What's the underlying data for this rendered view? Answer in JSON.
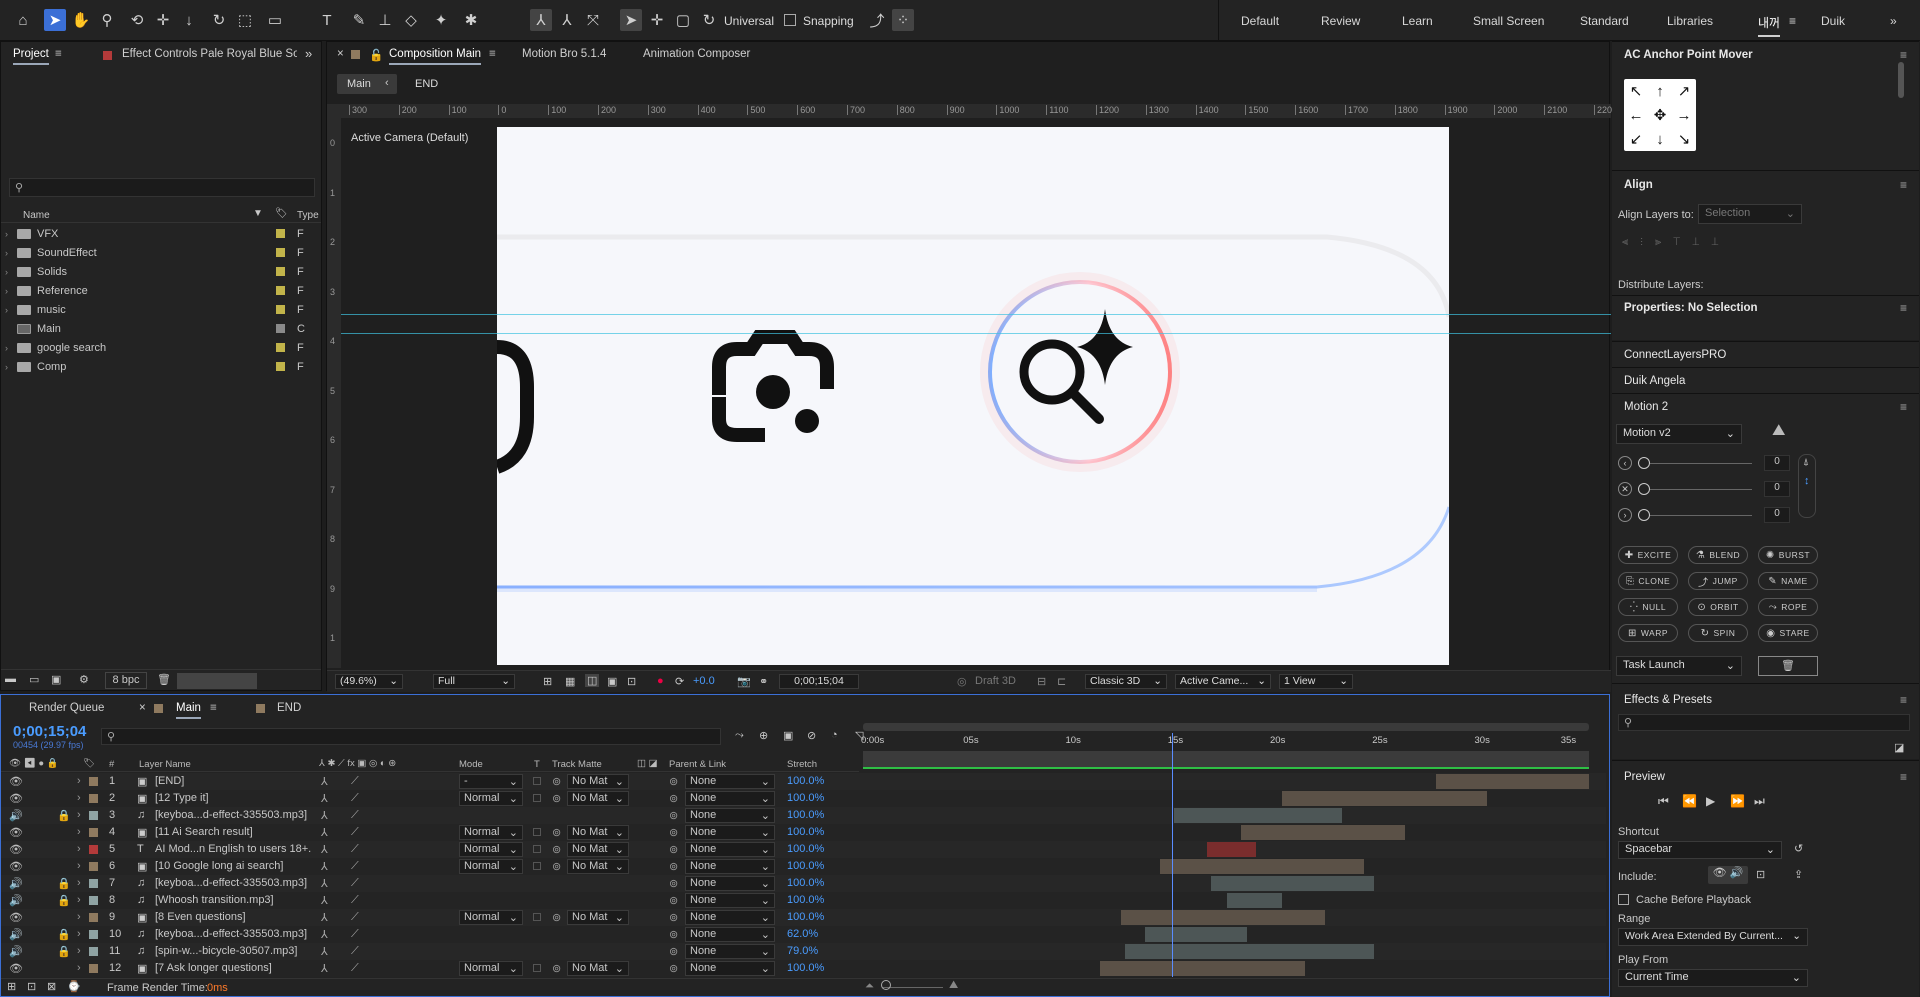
{
  "toolbar": {
    "universal": "Universal",
    "snapping": "Snapping",
    "workspaces": [
      "Default",
      "Review",
      "Learn",
      "Small Screen",
      "Standard",
      "Libraries",
      "내꺼",
      "Duik"
    ]
  },
  "project_panel": {
    "tab_project": "Project",
    "tab_effect_controls": "Effect Controls Pale Royal Blue Solid",
    "col_name": "Name",
    "col_type": "Type",
    "items": [
      {
        "name": "VFX",
        "type": "F",
        "color": "#c2b44a"
      },
      {
        "name": "SoundEffect",
        "type": "F",
        "color": "#c2b44a"
      },
      {
        "name": "Solids",
        "type": "F",
        "color": "#c2b44a"
      },
      {
        "name": "Reference",
        "type": "F",
        "color": "#c2b44a"
      },
      {
        "name": "music",
        "type": "F",
        "color": "#c2b44a"
      },
      {
        "name": "Main",
        "type": "C",
        "color": "#8a8a8a"
      },
      {
        "name": "google search",
        "type": "F",
        "color": "#c2b44a"
      },
      {
        "name": "Comp",
        "type": "F",
        "color": "#c2b44a"
      }
    ],
    "bpc": "8 bpc"
  },
  "comp_panel": {
    "tab_comp": "Composition Main",
    "tab_motion_bro": "Motion Bro 5.1.4",
    "tab_anim_composer": "Animation Composer",
    "flow_main": "Main",
    "flow_end": "END",
    "active_camera": "Active Camera (Default)",
    "ruler_top": [
      "300",
      "200",
      "100",
      "0",
      "100",
      "200",
      "300",
      "400",
      "500",
      "600",
      "700",
      "800",
      "900",
      "1000",
      "1100",
      "1200",
      "1300",
      "1400",
      "1500",
      "1600",
      "1700",
      "1800",
      "1900",
      "2000",
      "2100",
      "220"
    ],
    "ruler_left": [
      "0",
      "1",
      "2",
      "3",
      "4",
      "5",
      "6",
      "7",
      "8",
      "9",
      "1"
    ],
    "footer": {
      "zoom": "(49.6%)",
      "resolution": "Full",
      "exposure": "+0.0",
      "timecode": "0;00;15;04",
      "draft3d": "Draft 3D",
      "renderer": "Classic 3D",
      "camera": "Active Came...",
      "views": "1 View"
    }
  },
  "timeline": {
    "tab_render_queue": "Render Queue",
    "tab_main": "Main",
    "tab_end": "END",
    "timecode": "0;00;15;04",
    "frames": "00454 (29.97 fps)",
    "headers": {
      "num": "#",
      "layer_name": "Layer Name",
      "mode": "Mode",
      "t": "T",
      "track_matte": "Track Matte",
      "parent": "Parent & Link",
      "stretch": "Stretch"
    },
    "ruler": [
      "0:00s",
      "05s",
      "10s",
      "15s",
      "20s",
      "25s",
      "30s",
      "35s"
    ],
    "playhead": 15.1,
    "duration": 35.5,
    "layers": [
      {
        "num": "1",
        "name": "[END]",
        "mode": "-",
        "matte": "No Mat",
        "parent": "None",
        "stretch": "100.0%",
        "icon": "comp",
        "label": "#8f7a5f",
        "bar_start": 28,
        "bar_end": 35.5,
        "bar_color": "#5b5147"
      },
      {
        "num": "2",
        "name": "[12 Type it]",
        "mode": "Normal",
        "matte": "No Mat",
        "parent": "None",
        "stretch": "100.0%",
        "icon": "comp",
        "label": "#8f7a5f",
        "bar_start": 20.5,
        "bar_end": 30.5,
        "bar_color": "#5b5147"
      },
      {
        "num": "3",
        "name": "[keyboa...d-effect-335503.mp3]",
        "mode": "",
        "matte": "",
        "parent": "None",
        "stretch": "100.0%",
        "icon": "audio",
        "label": "#8fa3a3",
        "bar_start": 15.2,
        "bar_end": 23.4,
        "bar_color": "#4d5656"
      },
      {
        "num": "4",
        "name": "[11 Ai Search result]",
        "mode": "Normal",
        "matte": "No Mat",
        "parent": "None",
        "stretch": "100.0%",
        "icon": "comp",
        "label": "#8f7a5f",
        "bar_start": 18.5,
        "bar_end": 26.5,
        "bar_color": "#5b5147"
      },
      {
        "num": "5",
        "name": "AI Mod...n English to users 18+.",
        "mode": "Normal",
        "matte": "No Mat",
        "parent": "None",
        "stretch": "100.0%",
        "icon": "text",
        "label": "#b33a3a",
        "bar_start": 16.8,
        "bar_end": 19.2,
        "bar_color": "#7a2d2d"
      },
      {
        "num": "6",
        "name": "[10 Google long ai search]",
        "mode": "Normal",
        "matte": "No Mat",
        "parent": "None",
        "stretch": "100.0%",
        "icon": "comp",
        "label": "#8f7a5f",
        "bar_start": 14.5,
        "bar_end": 24.5,
        "bar_color": "#5b5147"
      },
      {
        "num": "7",
        "name": "[keyboa...d-effect-335503.mp3]",
        "mode": "",
        "matte": "",
        "parent": "None",
        "stretch": "100.0%",
        "icon": "audio",
        "label": "#8fa3a3",
        "bar_start": 17,
        "bar_end": 25,
        "bar_color": "#4d5656"
      },
      {
        "num": "8",
        "name": "[Whoosh transition.mp3]",
        "mode": "",
        "matte": "",
        "parent": "None",
        "stretch": "100.0%",
        "icon": "audio",
        "label": "#8fa3a3",
        "bar_start": 17.8,
        "bar_end": 20.5,
        "bar_color": "#4d5656"
      },
      {
        "num": "9",
        "name": "[8 Even questions]",
        "mode": "Normal",
        "matte": "No Mat",
        "parent": "None",
        "stretch": "100.0%",
        "icon": "comp",
        "label": "#8f7a5f",
        "bar_start": 12.6,
        "bar_end": 22.6,
        "bar_color": "#5b5147"
      },
      {
        "num": "10",
        "name": "[keyboa...d-effect-335503.mp3]",
        "mode": "",
        "matte": "",
        "parent": "None",
        "stretch": "62.0%",
        "icon": "audio",
        "label": "#8fa3a3",
        "bar_start": 13.8,
        "bar_end": 18.8,
        "bar_color": "#4d5656"
      },
      {
        "num": "11",
        "name": "[spin-w...-bicycle-30507.mp3]",
        "mode": "",
        "matte": "",
        "parent": "None",
        "stretch": "79.0%",
        "icon": "audio",
        "label": "#8fa3a3",
        "bar_start": 12.8,
        "bar_end": 25,
        "bar_color": "#4d5656"
      },
      {
        "num": "12",
        "name": "[7 Ask longer questions]",
        "mode": "Normal",
        "matte": "No Mat",
        "parent": "None",
        "stretch": "100.0%",
        "icon": "comp",
        "label": "#8f7a5f",
        "bar_start": 11.6,
        "bar_end": 21.6,
        "bar_color": "#5b5147"
      }
    ],
    "frame_render_label": "Frame Render Time:",
    "frame_render_value": "0ms"
  },
  "right": {
    "anchor_title": "AC Anchor Point Mover",
    "align_title": "Align",
    "align_to_label": "Align Layers to:",
    "align_to_value": "Selection",
    "distribute": "Distribute Layers:",
    "properties": "Properties: No Selection",
    "connect": "ConnectLayersPRO",
    "duik": "Duik Angela",
    "motion_title": "Motion 2",
    "motion_select": "Motion v2",
    "slider_values": [
      "0",
      "0",
      "0"
    ],
    "motion_buttons": [
      "EXCITE",
      "BLEND",
      "BURST",
      "CLONE",
      "JUMP",
      "NAME",
      "NULL",
      "ORBIT",
      "ROPE",
      "WARP",
      "SPIN",
      "STARE"
    ],
    "task": "Task Launch",
    "effects_title": "Effects & Presets",
    "preview_title": "Preview",
    "shortcut_label": "Shortcut",
    "shortcut_value": "Spacebar",
    "include_label": "Include:",
    "cache_label": "Cache Before Playback",
    "range_label": "Range",
    "range_value": "Work Area Extended By Current...",
    "play_from_label": "Play From",
    "play_from_value": "Current Time"
  }
}
